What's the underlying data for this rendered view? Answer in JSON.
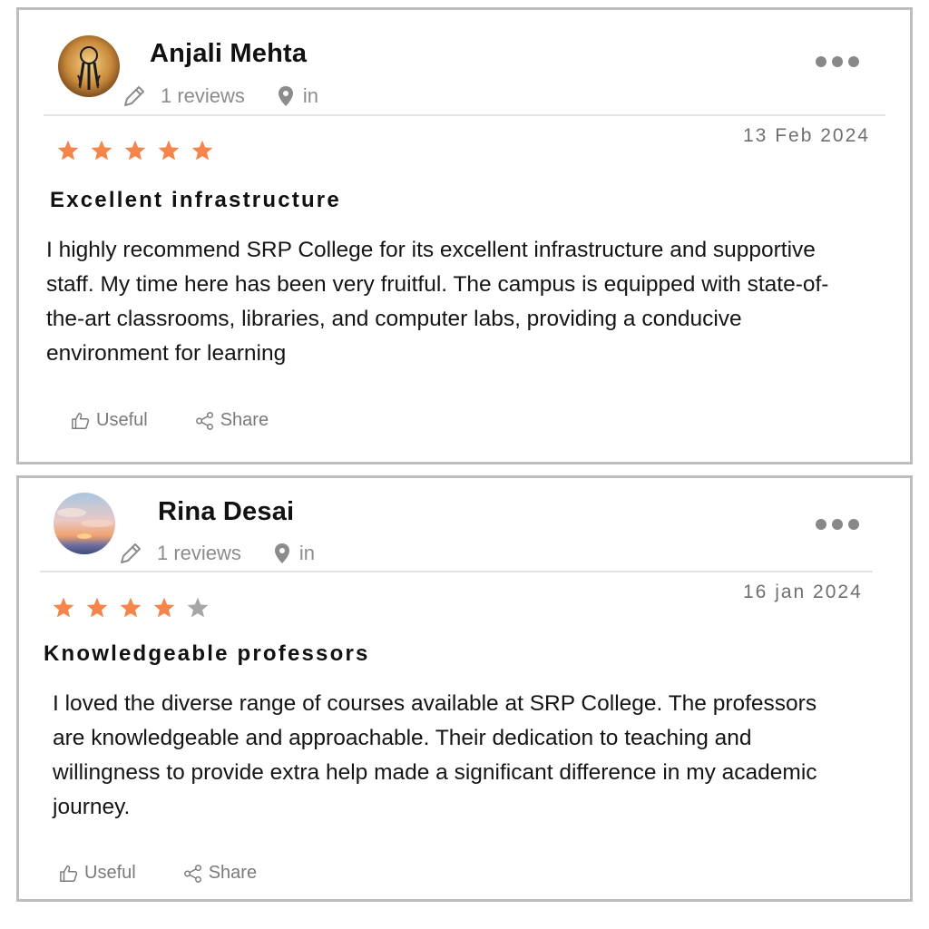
{
  "colors": {
    "star_filled": "#f5854a",
    "star_empty": "#a6a6a6",
    "border": "#bdbdbd",
    "meta_text": "#8c8c8c"
  },
  "reviews": [
    {
      "name": "Anjali Mehta",
      "reviews_count": "1 reviews",
      "location": "in",
      "date": "13 Feb 2024",
      "rating": 5,
      "title": "Excellent infrastructure",
      "body": "I highly recommend SRP College for its excellent infrastructure and supportive staff. My time here has been very fruitful. The campus is equipped with state-of-the-art classrooms, libraries, and computer labs, providing a conducive environment for learning",
      "useful_label": "Useful",
      "share_label": "Share",
      "avatar_icon": "dreamcatcher-avatar-icon"
    },
    {
      "name": "Rina Desai",
      "reviews_count": "1 reviews",
      "location": "in",
      "date": "16 jan 2024",
      "rating": 4,
      "title": "Knowledgeable professors",
      "body": "I loved the diverse range of courses available at SRP College. The professors are knowledgeable and approachable. Their dedication to teaching and willingness to provide extra help made a significant difference in my academic journey.",
      "useful_label": "Useful",
      "share_label": "Share",
      "avatar_icon": "sunset-avatar-icon"
    }
  ]
}
